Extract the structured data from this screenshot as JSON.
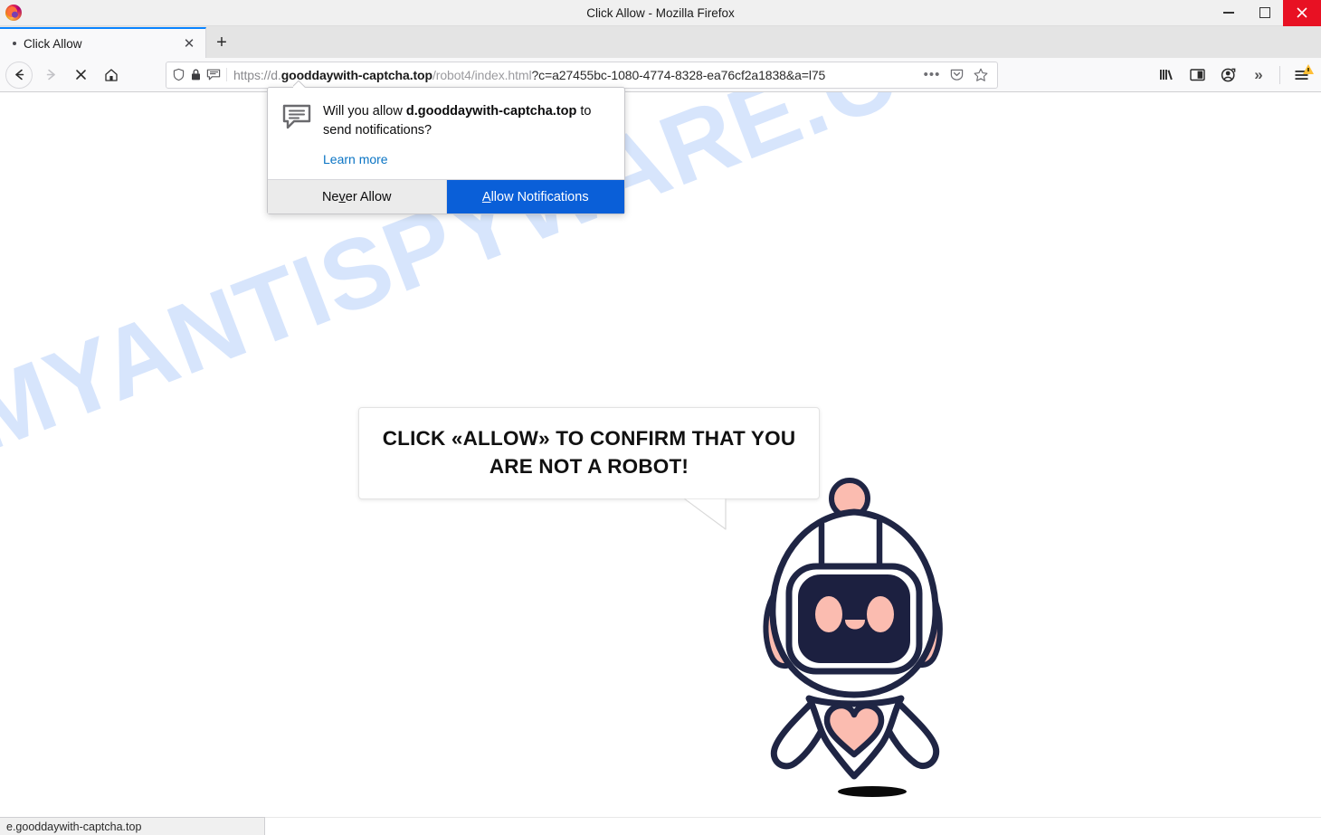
{
  "window": {
    "title": "Click Allow - Mozilla Firefox",
    "logo_icon": "firefox-logo",
    "controls": {
      "minimize_label": "—",
      "maximize_label": "□",
      "close_label": "✕"
    }
  },
  "tabs": [
    {
      "label": "Click Allow",
      "unread_dot": "•",
      "close_label": "✕",
      "active": true
    }
  ],
  "newtab": {
    "label": "+"
  },
  "nav": {
    "back_icon": "back-arrow-icon",
    "forward_icon": "forward-arrow-icon",
    "stop_icon": "stop-x-icon",
    "home_icon": "home-icon"
  },
  "urlbar": {
    "shield_icon": "tracking-protection-shield-icon",
    "lock_icon": "padlock-icon",
    "permission_icon": "notification-bubble-icon",
    "scheme": "https://d.",
    "host": "gooddaywith-captcha.top",
    "path": "/robot4/index.html",
    "query": "?c=a27455bc-1080-4774-8328-ea76cf2a1838&a=l75",
    "full_url": "https://d.gooddaywith-captcha.top/robot4/index.html?c=a27455bc-1080-4774-8328-ea76cf2a1838&a=l75",
    "page_actions_label": "•••",
    "pocket_icon": "pocket-save-icon",
    "bookmark_icon": "bookmark-star-icon"
  },
  "toolbar_right": {
    "library_icon": "library-icon",
    "sidebar_icon": "sidebar-toggle-icon",
    "account_icon": "account-sync-icon",
    "overflow_label": "»",
    "menu_icon": "hamburger-menu-icon",
    "menu_badge_icon": "warning-triangle-icon"
  },
  "notification": {
    "icon": "notification-bubble-icon",
    "message_prefix": "Will you allow ",
    "message_domain": "d.gooddaywith-captcha.top",
    "message_suffix": " to send notifications?",
    "learn_more": "Learn more",
    "never_allow": {
      "pre": "Ne",
      "accel": "v",
      "post": "er Allow",
      "full": "Never Allow"
    },
    "allow": {
      "accel": "A",
      "post": "llow Notifications",
      "full": "Allow Notifications"
    },
    "primary_color": "#0a5fd8",
    "secondary_color": "#ebebeb",
    "link_color": "#0a74c4"
  },
  "page": {
    "watermark": "MYANTISPYWARE.COM",
    "watermark_color": "#c9dcfb",
    "bubble_text": "CLICK «ALLOW» TO CONFIRM THAT YOU ARE NOT A ROBOT!",
    "robot_icon": "robot-mascot-illustration",
    "robot_outline_color": "#1f2544",
    "robot_accent_color": "#fbbcb0",
    "robot_screen_color": "#1c2040"
  },
  "statusbar": {
    "text": "e.gooddaywith-captcha.top"
  }
}
